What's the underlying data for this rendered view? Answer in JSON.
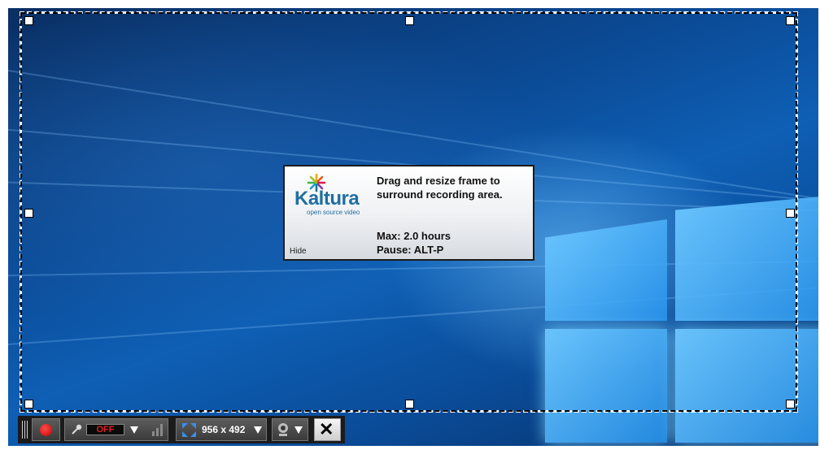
{
  "tooltip": {
    "logo_word": "Kaltura",
    "logo_tagline": "open source video",
    "line1": "Drag and resize frame to\nsurround recording area.",
    "line2": "Max: 2.0 hours\nPause: ALT-P",
    "hide_label": "Hide"
  },
  "toolbar": {
    "mic_status": "OFF",
    "dimensions": "956 x 492",
    "icons": [
      "grip-icon",
      "record-icon",
      "microphone-icon",
      "dropdown-arrow-icon",
      "audio-level-icon",
      "fullscreen-icon",
      "dropdown-arrow-icon",
      "webcam-icon",
      "dropdown-arrow-icon",
      "close-icon"
    ]
  },
  "colors": {
    "record": "#e00000",
    "off_text": "#e02020",
    "brand": "#1f6fa0"
  }
}
